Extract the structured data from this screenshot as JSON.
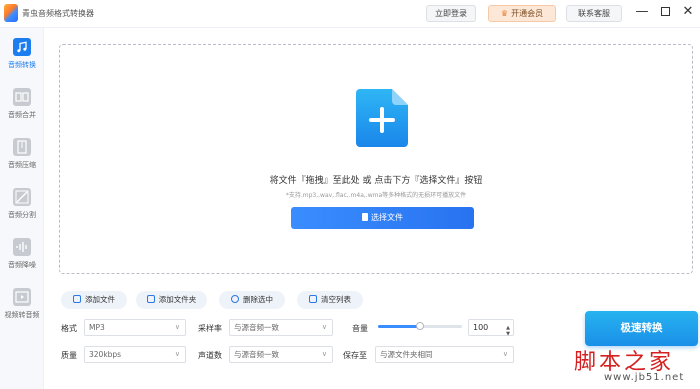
{
  "app": {
    "title": "青虫音频格式转换器"
  },
  "titlebar": {
    "login_label": "立即登录",
    "vip_label": "开通会员",
    "vip_icon": "crown-icon",
    "service_label": "联系客服",
    "minimize_glyph": "—",
    "close_glyph": "✕"
  },
  "sidebar": {
    "items": [
      {
        "label": "音频转换",
        "icon": "music-note-icon",
        "active": true
      },
      {
        "label": "音频合并",
        "icon": "merge-icon"
      },
      {
        "label": "音频压缩",
        "icon": "zip-icon"
      },
      {
        "label": "音频分割",
        "icon": "split-icon"
      },
      {
        "label": "音频降噪",
        "icon": "waveform-icon"
      },
      {
        "label": "视频转音频",
        "icon": "film-icon"
      }
    ]
  },
  "dropzone": {
    "title": "将文件『拖拽』至此处 或 点击下方『选择文件』按钮",
    "subtitle": "*支持.mp3,.wav,.flac,.m4a,.wma等多种格式的无损环可播放文件",
    "choose_label": "选择文件",
    "plus_glyph": "+"
  },
  "actions": {
    "add_file": "添加文件",
    "add_folder": "添加文件夹",
    "delete_selected": "删除选中",
    "clear_list": "清空列表"
  },
  "settings": {
    "format_label": "格式",
    "format_value": "MP3",
    "quality_label": "质量",
    "quality_value": "320kbps",
    "samplerate_label": "采样率",
    "samplerate_value": "与源音频一致",
    "channels_label": "声道数",
    "channels_value": "与源音频一致",
    "volume_label": "音量",
    "volume_value": "100",
    "volume_level": 0.5,
    "saveto_label": "保存至",
    "saveto_value": "与源文件夹相同"
  },
  "convert_label": "极速转换",
  "watermark": {
    "big": "脚本之家",
    "small": "www.jb51.net"
  },
  "colors": {
    "accent": "#1c7df0",
    "convert": "#1a8fe8",
    "vip_bg": "#fde7d6"
  }
}
